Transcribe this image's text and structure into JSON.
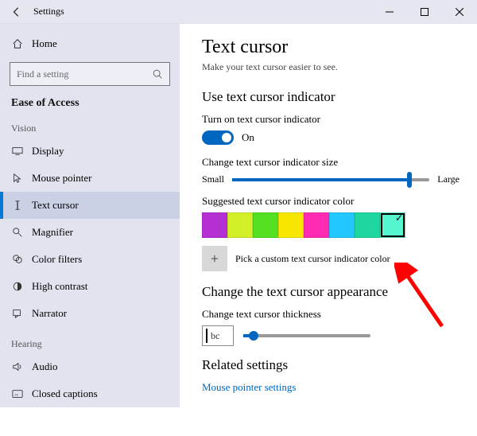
{
  "window": {
    "title": "Settings"
  },
  "sidebar": {
    "home": "Home",
    "search_placeholder": "Find a setting",
    "ease_head": "Ease of Access",
    "groups": {
      "vision_label": "Vision",
      "hearing_label": "Hearing"
    },
    "items": {
      "display": "Display",
      "mouse_pointer": "Mouse pointer",
      "text_cursor": "Text cursor",
      "magnifier": "Magnifier",
      "color_filters": "Color filters",
      "high_contrast": "High contrast",
      "narrator": "Narrator",
      "audio": "Audio",
      "closed_captions": "Closed captions"
    }
  },
  "main": {
    "title": "Text cursor",
    "subtitle": "Make your text cursor easier to see.",
    "indicator_head": "Use text cursor indicator",
    "toggle_label": "Turn on text cursor indicator",
    "toggle_state": "On",
    "size_label": "Change text cursor indicator size",
    "size_small": "Small",
    "size_large": "Large",
    "size_value_percent": 90,
    "color_label": "Suggested text cursor indicator color",
    "colors": [
      {
        "hex": "#b430d3",
        "selected": false,
        "dark": true
      },
      {
        "hex": "#d2ef27",
        "selected": false,
        "dark": false
      },
      {
        "hex": "#54e020",
        "selected": false,
        "dark": false
      },
      {
        "hex": "#f7e600",
        "selected": false,
        "dark": false
      },
      {
        "hex": "#ff2bb2",
        "selected": false,
        "dark": true
      },
      {
        "hex": "#22c7ff",
        "selected": false,
        "dark": false
      },
      {
        "hex": "#1fd6a0",
        "selected": false,
        "dark": false
      },
      {
        "hex": "#55f5d0",
        "selected": true,
        "dark": false
      }
    ],
    "custom_label": "Pick a custom text cursor indicator color",
    "appearance_head": "Change the text cursor appearance",
    "thickness_label": "Change text cursor thickness",
    "thickness_preview": "bc",
    "thickness_value_percent": 8,
    "related_head": "Related settings",
    "related_link": "Mouse pointer settings"
  }
}
